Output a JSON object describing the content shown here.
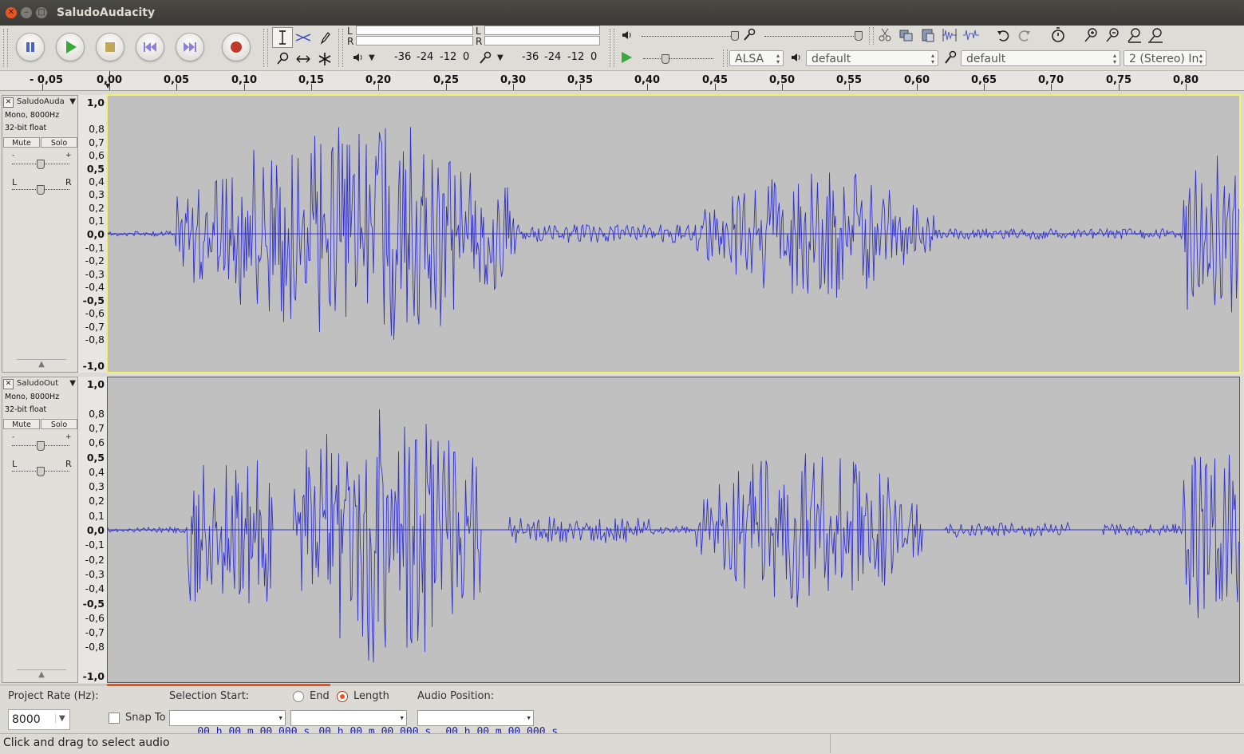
{
  "window": {
    "title": "SaludoAudacity"
  },
  "transport": {
    "buttons": [
      "pause",
      "play",
      "stop",
      "skip-to-start",
      "skip-to-end",
      "record"
    ]
  },
  "meters": {
    "lr_top": "L",
    "lr_bottom": "R",
    "playback_ticks": [
      "-36",
      "-24",
      "-12",
      "0"
    ],
    "record_ticks": [
      "-36",
      "-24",
      "-12",
      "0"
    ]
  },
  "device": {
    "host": "ALSA",
    "playback_device": "default",
    "recording_device": "default",
    "channels": "2 (Stereo) In"
  },
  "ruler": {
    "labels": [
      "- 0,05",
      "0,00",
      "0,05",
      "0,10",
      "0,15",
      "0,20",
      "0,25",
      "0,30",
      "0,35",
      "0,40",
      "0,45",
      "0,50",
      "0,55",
      "0,60",
      "0,65",
      "0,70",
      "0,75",
      "0,80"
    ]
  },
  "tracks": [
    {
      "name": "SaludoAuda",
      "info_line1": "Mono, 8000Hz",
      "info_line2": "32-bit float",
      "mute_label": "Mute",
      "solo_label": "Solo",
      "gain_minus": "-",
      "gain_plus": "+",
      "pan_left": "L",
      "pan_right": "R",
      "focused": true
    },
    {
      "name": "SaludoOut",
      "info_line1": "Mono, 8000Hz",
      "info_line2": "32-bit float",
      "mute_label": "Mute",
      "solo_label": "Solo",
      "gain_minus": "-",
      "gain_plus": "+",
      "pan_left": "L",
      "pan_right": "R",
      "focused": false
    }
  ],
  "vertical_scale": [
    {
      "t": "1,0",
      "b": true
    },
    {
      "t": "0,8",
      "b": false
    },
    {
      "t": "0,7",
      "b": false
    },
    {
      "t": "0,6",
      "b": false
    },
    {
      "t": "0,5",
      "b": true
    },
    {
      "t": "0,4",
      "b": false
    },
    {
      "t": "0,3",
      "b": false
    },
    {
      "t": "0,2",
      "b": false
    },
    {
      "t": "0,1",
      "b": false
    },
    {
      "t": "0,0",
      "b": true
    },
    {
      "t": "-0,1",
      "b": false
    },
    {
      "t": "-0,2",
      "b": false
    },
    {
      "t": "-0,3",
      "b": false
    },
    {
      "t": "-0,4",
      "b": false
    },
    {
      "t": "-0,5",
      "b": true
    },
    {
      "t": "-0,6",
      "b": false
    },
    {
      "t": "-0,7",
      "b": false
    },
    {
      "t": "-0,8",
      "b": false
    },
    {
      "t": "-1,0",
      "b": true
    }
  ],
  "selection_toolbar": {
    "project_rate_label": "Project Rate (Hz):",
    "project_rate_value": "8000",
    "snap_to_label": "Snap To",
    "selection_start_label": "Selection Start:",
    "end_label": "End",
    "length_label": "Length",
    "length_selected": true,
    "audio_position_label": "Audio Position:",
    "selection_start_value": "00 h 00 m 00.000 s",
    "length_value": "00 h 00 m 00.000 s",
    "audio_position_value": "00 h 00 m 00.000 s"
  },
  "status": {
    "text": "Click and drag to select audio"
  },
  "colors": {
    "waveform": "#3232c8",
    "wave_bg": "#c0c0c0",
    "record": "#c0392b",
    "play": "#2e9e2e",
    "accent": "#e95420"
  }
}
